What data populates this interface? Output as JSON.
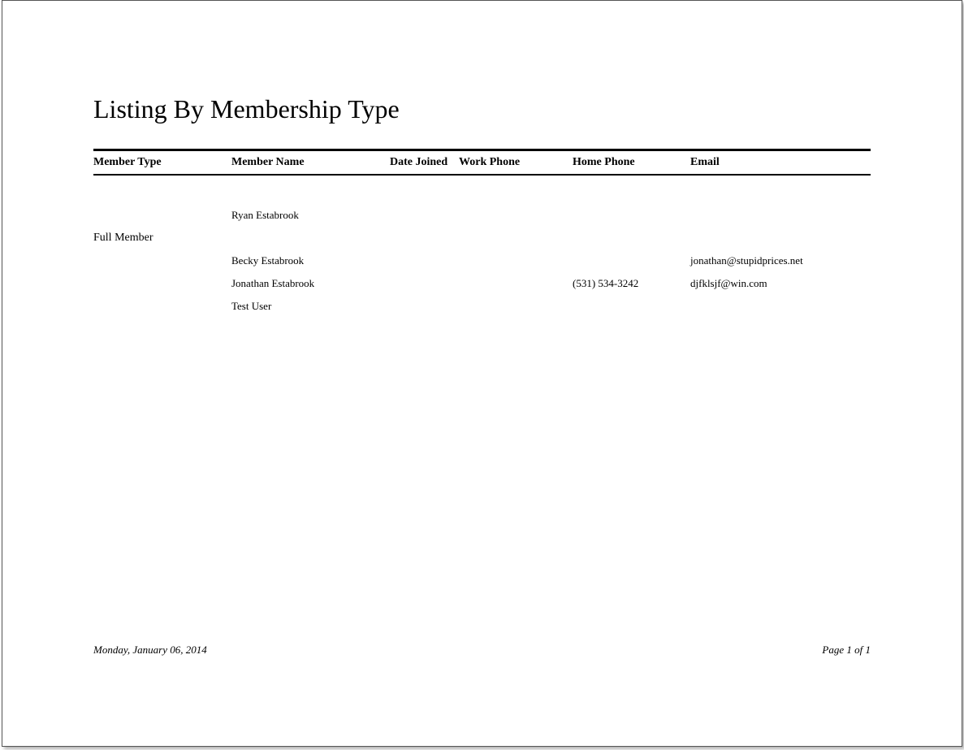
{
  "title": "Listing By Membership Type",
  "columns": {
    "type": "Member Type",
    "name": "Member Name",
    "date": "Date Joined",
    "work": "Work Phone",
    "home": "Home Phone",
    "email": "Email"
  },
  "rows": {
    "0": {
      "type": "",
      "name": "Ryan Estabrook",
      "date": "",
      "work": "",
      "home": "",
      "email": ""
    },
    "group1": {
      "label": "Full Member"
    },
    "1": {
      "type": "",
      "name": "Becky Estabrook",
      "date": "",
      "work": "",
      "home": "",
      "email": "jonathan@stupidprices.net"
    },
    "2": {
      "type": "",
      "name": "Jonathan Estabrook",
      "date": "",
      "work": "",
      "home": "(531) 534-3242",
      "email": "djfklsjf@win.com"
    },
    "3": {
      "type": "",
      "name": "Test User",
      "date": "",
      "work": "",
      "home": "",
      "email": ""
    }
  },
  "footer": {
    "date": "Monday, January 06, 2014",
    "page": "Page 1 of 1"
  }
}
